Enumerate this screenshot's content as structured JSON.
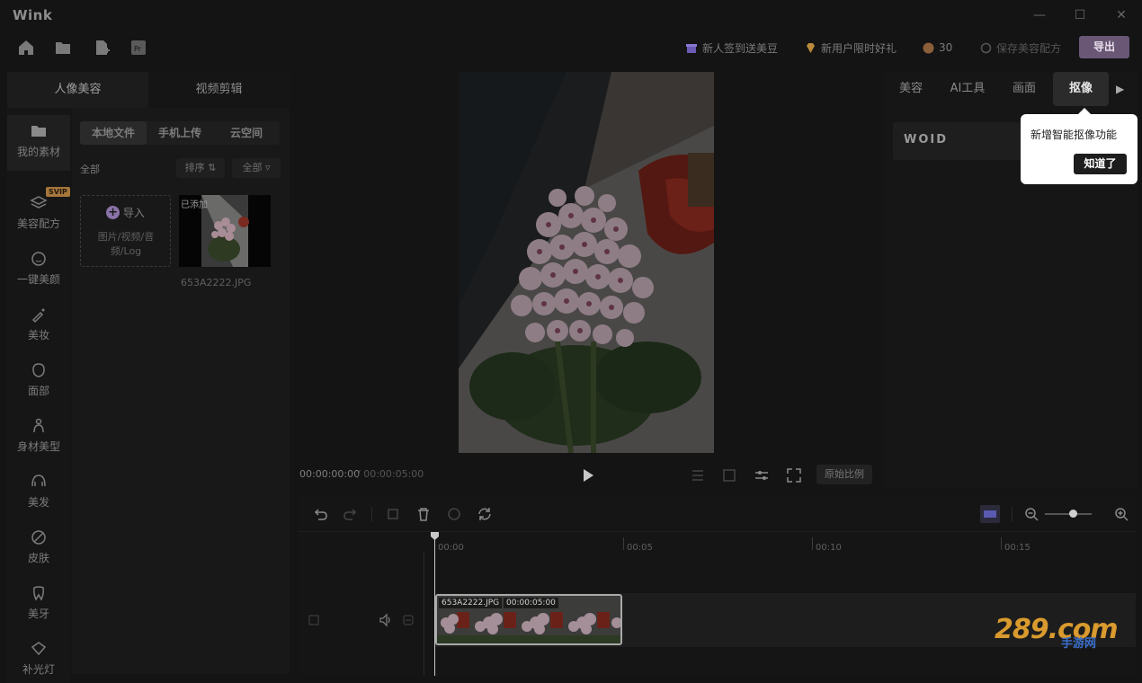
{
  "app": {
    "title": "Wink"
  },
  "window_controls": {
    "minimize": "—",
    "maximize": "☐",
    "close": "✕"
  },
  "toolbar": {
    "checkin": "新人签到送美豆",
    "newuser_gift": "新用户限时好礼",
    "beans_count": "30",
    "save_recipe": "保存美容配方",
    "export": "导出"
  },
  "left_tabs": [
    "人像美容",
    "视频剪辑"
  ],
  "sidebar": {
    "items": [
      {
        "label": "我的素材",
        "icon": "folder-icon"
      },
      {
        "label": "美容配方",
        "icon": "layers-icon",
        "badge": "SVIP"
      },
      {
        "label": "一键美颜",
        "icon": "face-smile-icon"
      },
      {
        "label": "美妆",
        "icon": "makeup-brush-icon"
      },
      {
        "label": "面部",
        "icon": "face-outline-icon"
      },
      {
        "label": "身材美型",
        "icon": "body-icon"
      },
      {
        "label": "美发",
        "icon": "hair-icon"
      },
      {
        "label": "皮肤",
        "icon": "skin-icon"
      },
      {
        "label": "美牙",
        "icon": "tooth-icon"
      },
      {
        "label": "补光灯",
        "icon": "light-icon"
      }
    ]
  },
  "assets": {
    "source_tabs": [
      "本地文件",
      "手机上传",
      "云空间"
    ],
    "filter_label": "全部",
    "sort_label": "排序",
    "filter_all": "全部",
    "import_label": "导入",
    "import_hint": "图片/视频/音频/Log",
    "added_badge": "已添加",
    "file_name": "653A2222.JPG"
  },
  "player": {
    "current_time": "00:00:00:00",
    "total_time": "/ 00:00:05:00",
    "original_ratio": "原始比例"
  },
  "right_tabs": [
    "美容",
    "AI工具",
    "画面",
    "抠像"
  ],
  "right_content": {
    "code_text": "WOID"
  },
  "tooltip": {
    "text": "新增智能抠像功能",
    "button": "知道了"
  },
  "timeline": {
    "ruler": [
      "00:00",
      "00:05",
      "00:10",
      "00:15"
    ],
    "clip_name": "653A2222.JPG",
    "clip_duration": "00:00:05:00"
  },
  "watermark": {
    "text": "289.com",
    "subtext": "手游网"
  },
  "colors": {
    "accent": "#6a5775",
    "background": "#141414",
    "panel": "#161616"
  }
}
